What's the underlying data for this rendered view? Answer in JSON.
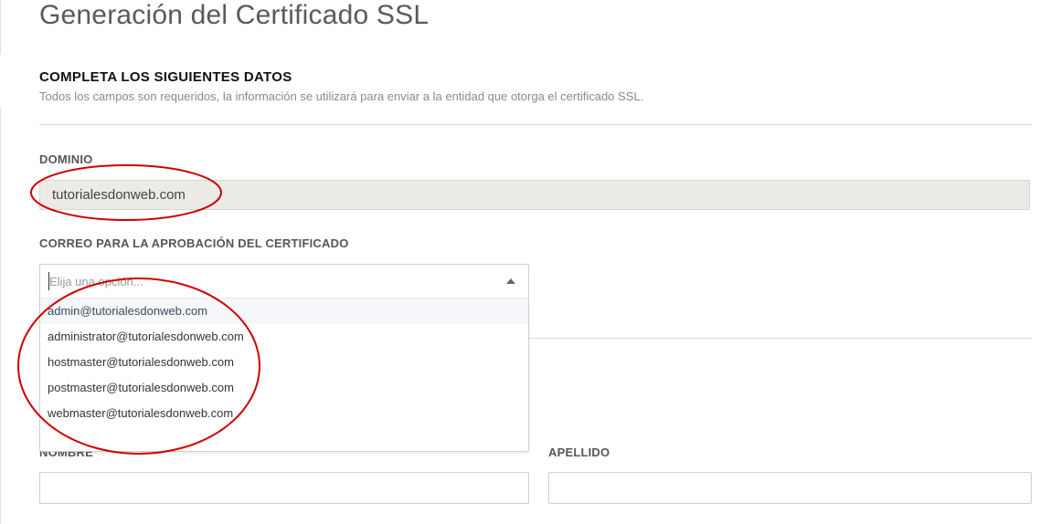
{
  "page_title": "Generación del Certificado SSL",
  "section": {
    "title": "COMPLETA LOS SIGUIENTES DATOS",
    "subtitle": "Todos los campos son requeridos, la información se utilizará para enviar a la entidad que otorga el certificado SSL."
  },
  "domain": {
    "label": "DOMINIO",
    "value": "tutorialesdonweb.com"
  },
  "approval_email": {
    "label": "CORREO PARA LA APROBACIÓN DEL CERTIFICADO",
    "placeholder": "Elija una opción...",
    "options": [
      "admin@tutorialesdonweb.com",
      "administrator@tutorialesdonweb.com",
      "hostmaster@tutorialesdonweb.com",
      "postmaster@tutorialesdonweb.com",
      "webmaster@tutorialesdonweb.com"
    ],
    "highlighted_index": 0
  },
  "name_fields": {
    "first_name_label": "NOMBRE",
    "last_name_label": "APELLIDO"
  },
  "colors": {
    "annotation": "#d00000",
    "domain_bg": "#ecebe8"
  },
  "icons": {
    "dropdown_caret": "caret-up-icon"
  }
}
